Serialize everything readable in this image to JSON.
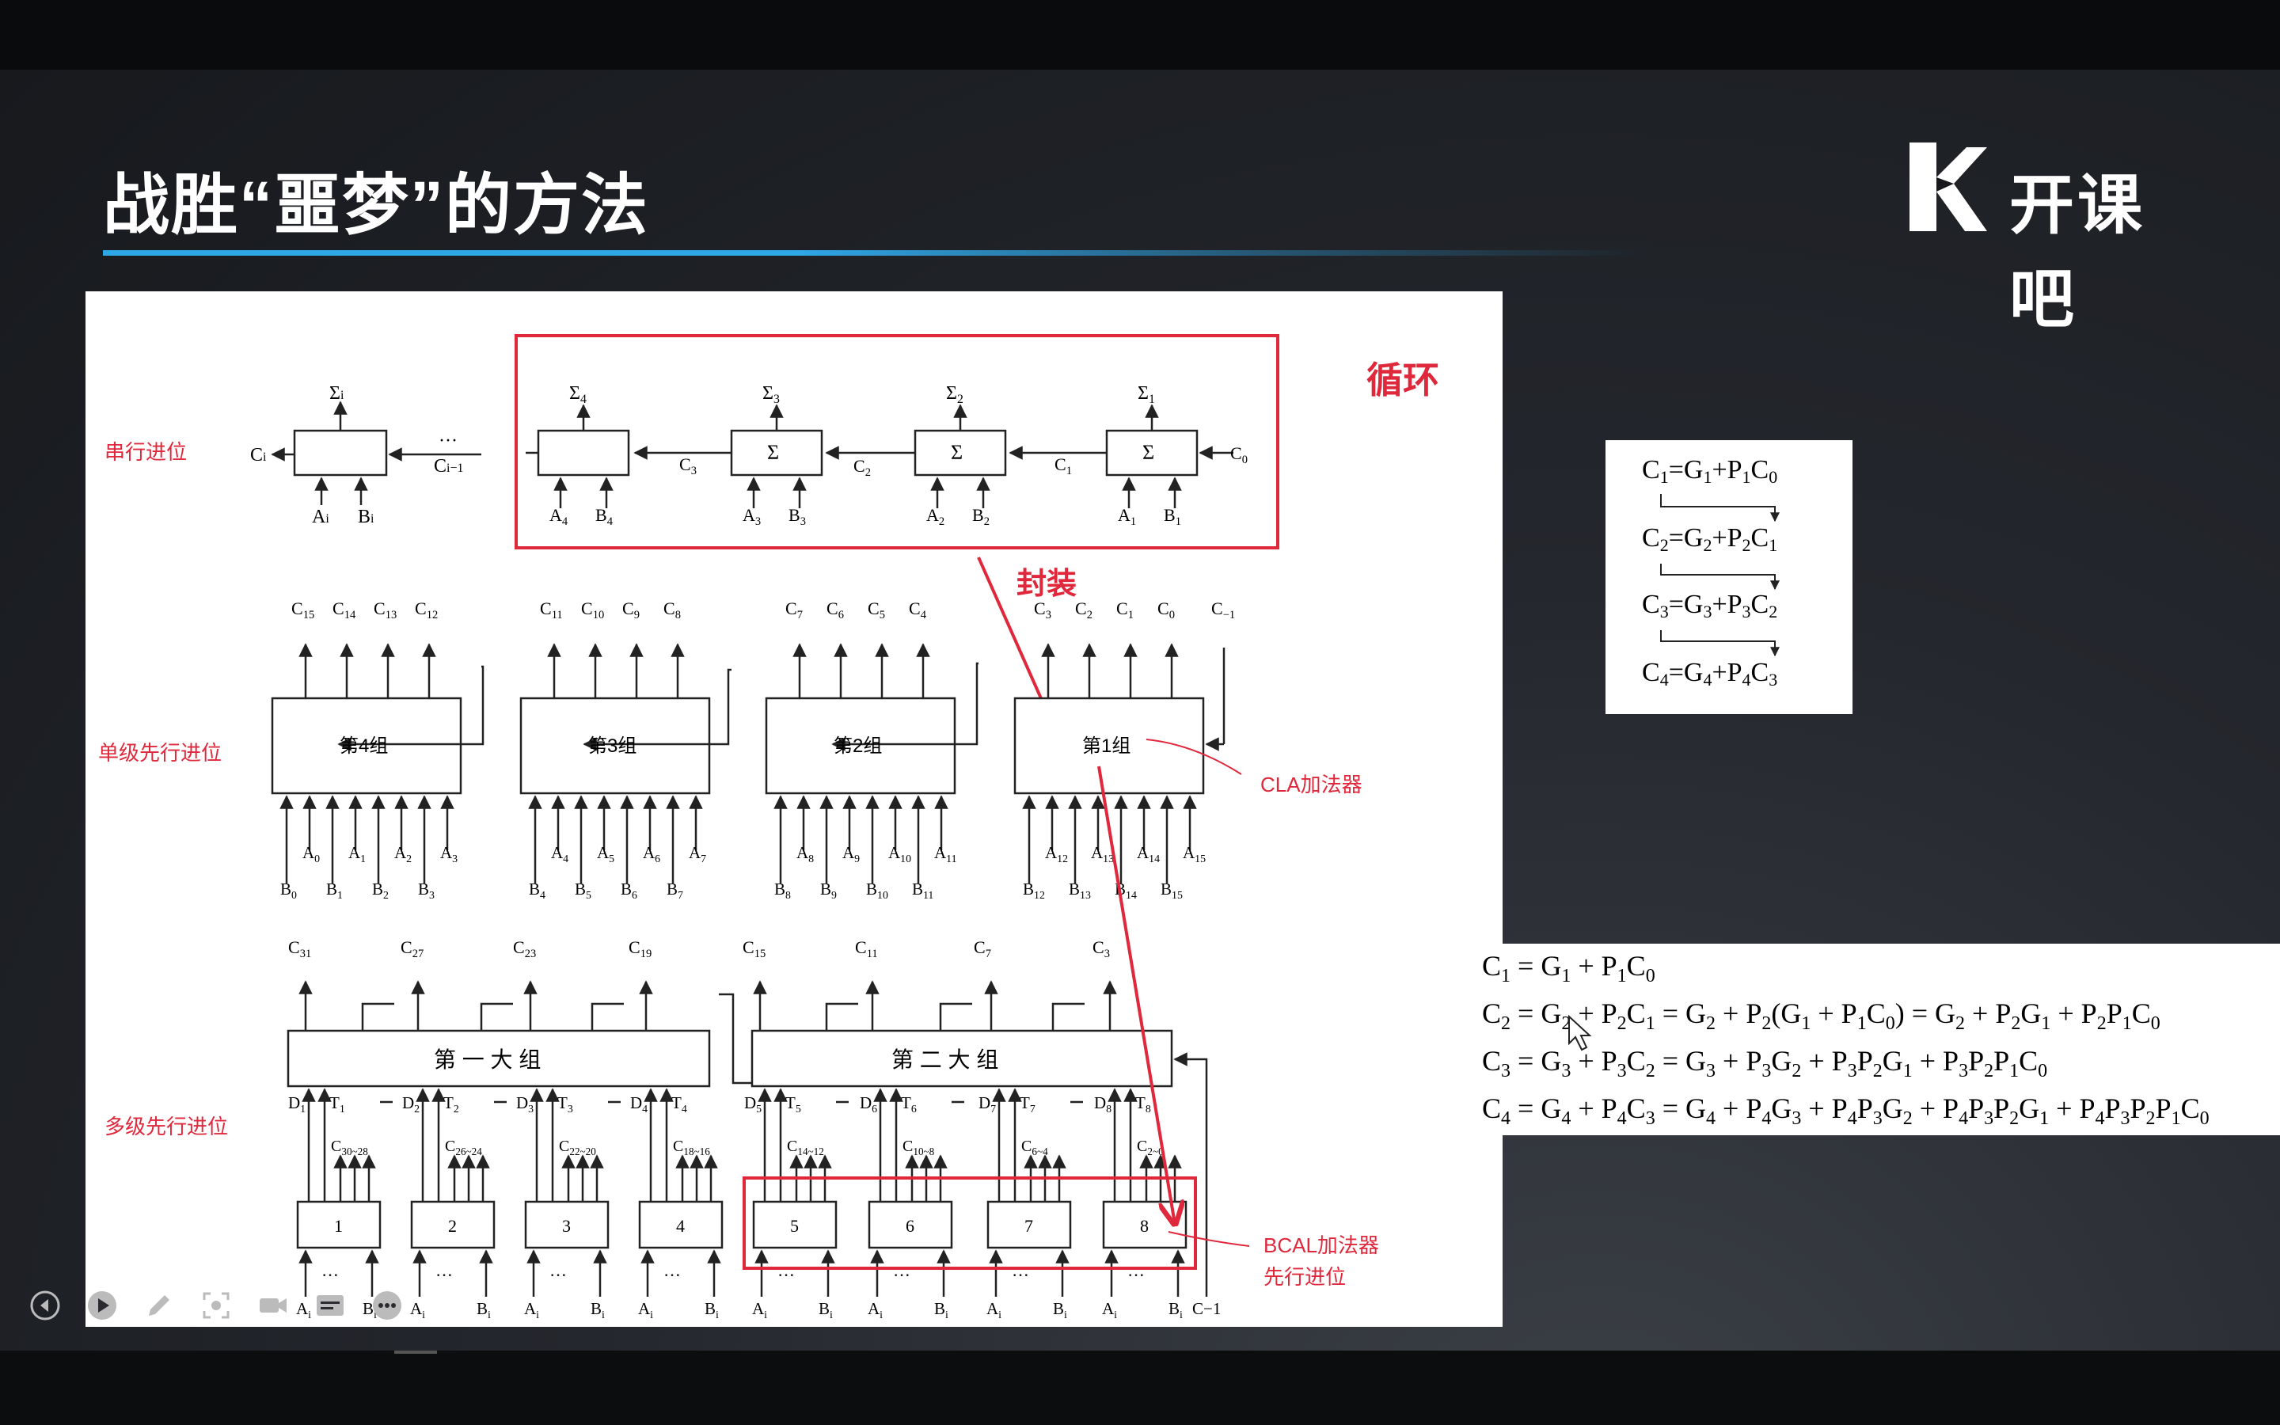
{
  "slide": {
    "title": "战胜“噩梦”的方法",
    "logo_text": "开课吧",
    "accent_color": "#2fa6e6"
  },
  "diagram": {
    "row_labels": {
      "serial": "串行进位",
      "single": "单级先行进位",
      "multi": "多级先行进位"
    },
    "annotations": {
      "loop": "循环",
      "encapsulate": "封装",
      "cla": "CLA加法器",
      "bcal_line1": "BCAL加法器",
      "bcal_line2": "先行进位"
    },
    "serial_single": {
      "sigma": "Σ",
      "sub": "i",
      "left": "C",
      "left_sub": "i",
      "right": "C",
      "right_sub": "i−1",
      "dots": "···",
      "a": "A",
      "a_sub": "i",
      "b": "B",
      "b_sub": "i"
    },
    "serial_chain": {
      "sigma": "Σ",
      "outputs": [
        "4",
        "3",
        "2",
        "1"
      ],
      "carries": [
        "C",
        "C",
        "C",
        "C"
      ],
      "carry_subs": [
        "3",
        "2",
        "1",
        "0"
      ],
      "inputs_a": [
        "4",
        "3",
        "2",
        "1"
      ],
      "inputs_b": [
        "4",
        "3",
        "2",
        "1"
      ]
    },
    "single_level": {
      "groups": [
        "第4组",
        "第3组",
        "第2组",
        "第1组"
      ],
      "carries": [
        [
          "15",
          "14",
          "13",
          "12"
        ],
        [
          "11",
          "10",
          "9",
          "8"
        ],
        [
          "7",
          "6",
          "5",
          "4"
        ],
        [
          "3",
          "2",
          "1",
          "0",
          "−1"
        ]
      ],
      "a_inputs": [
        [
          "0",
          "1",
          "2",
          "3"
        ],
        [
          "4",
          "5",
          "6",
          "7"
        ],
        [
          "8",
          "9",
          "10",
          "11"
        ],
        [
          "12",
          "13",
          "14",
          "15"
        ]
      ],
      "b_inputs": [
        [
          "0",
          "1",
          "2",
          "3"
        ],
        [
          "4",
          "5",
          "6",
          "7"
        ],
        [
          "8",
          "9",
          "10",
          "11"
        ],
        [
          "12",
          "13",
          "14",
          "15"
        ]
      ]
    },
    "multi_level": {
      "big_group_1": "第 一 大 组",
      "big_group_2": "第 二 大 组",
      "top_carries": [
        "31",
        "27",
        "23",
        "19",
        "15",
        "11",
        "7",
        "3"
      ],
      "dt": [
        [
          "1",
          "1"
        ],
        [
          "2",
          "2"
        ],
        [
          "3",
          "3"
        ],
        [
          "4",
          "4"
        ],
        [
          "5",
          "5"
        ],
        [
          "6",
          "6"
        ],
        [
          "7",
          "7"
        ],
        [
          "8",
          "8"
        ]
      ],
      "inner_carries": [
        "30~28",
        "26~24",
        "22~20",
        "18~16",
        "14~12",
        "10~8",
        "6~4",
        "2~0"
      ],
      "block_numbers": [
        "1",
        "2",
        "3",
        "4",
        "5",
        "6",
        "7",
        "8"
      ],
      "input_dots": "···",
      "input_a": "A",
      "input_b": "B",
      "input_sub": "i",
      "c_minus1": "C−1"
    }
  },
  "equations_box": {
    "lines": [
      "C1=G1+P1C0",
      "C2=G2+P2C1",
      "C3=G3+P3C2",
      "C4=G4+P4C3"
    ]
  },
  "expanded_equations": {
    "lines": [
      "C1 = G1 + P1C0",
      "C2 = G2 + P2C1 = G2 + P2(G1 + P1C0) = G2 + P2G1 + P2P1C0",
      "C3 = G3 + P3C2 = G3 + P3G2 + P3P2G1 + P3P2P1C0",
      "C4 = G4 + P4C3 = G4 + P4G3 + P4P3G2 + P4P3P2G1 + P4P3P2P1C0"
    ]
  },
  "controls": {
    "items": [
      "back-icon",
      "play-icon",
      "pen-icon",
      "screenshot-icon",
      "camera-icon",
      "subtitle-icon",
      "more-icon"
    ]
  }
}
